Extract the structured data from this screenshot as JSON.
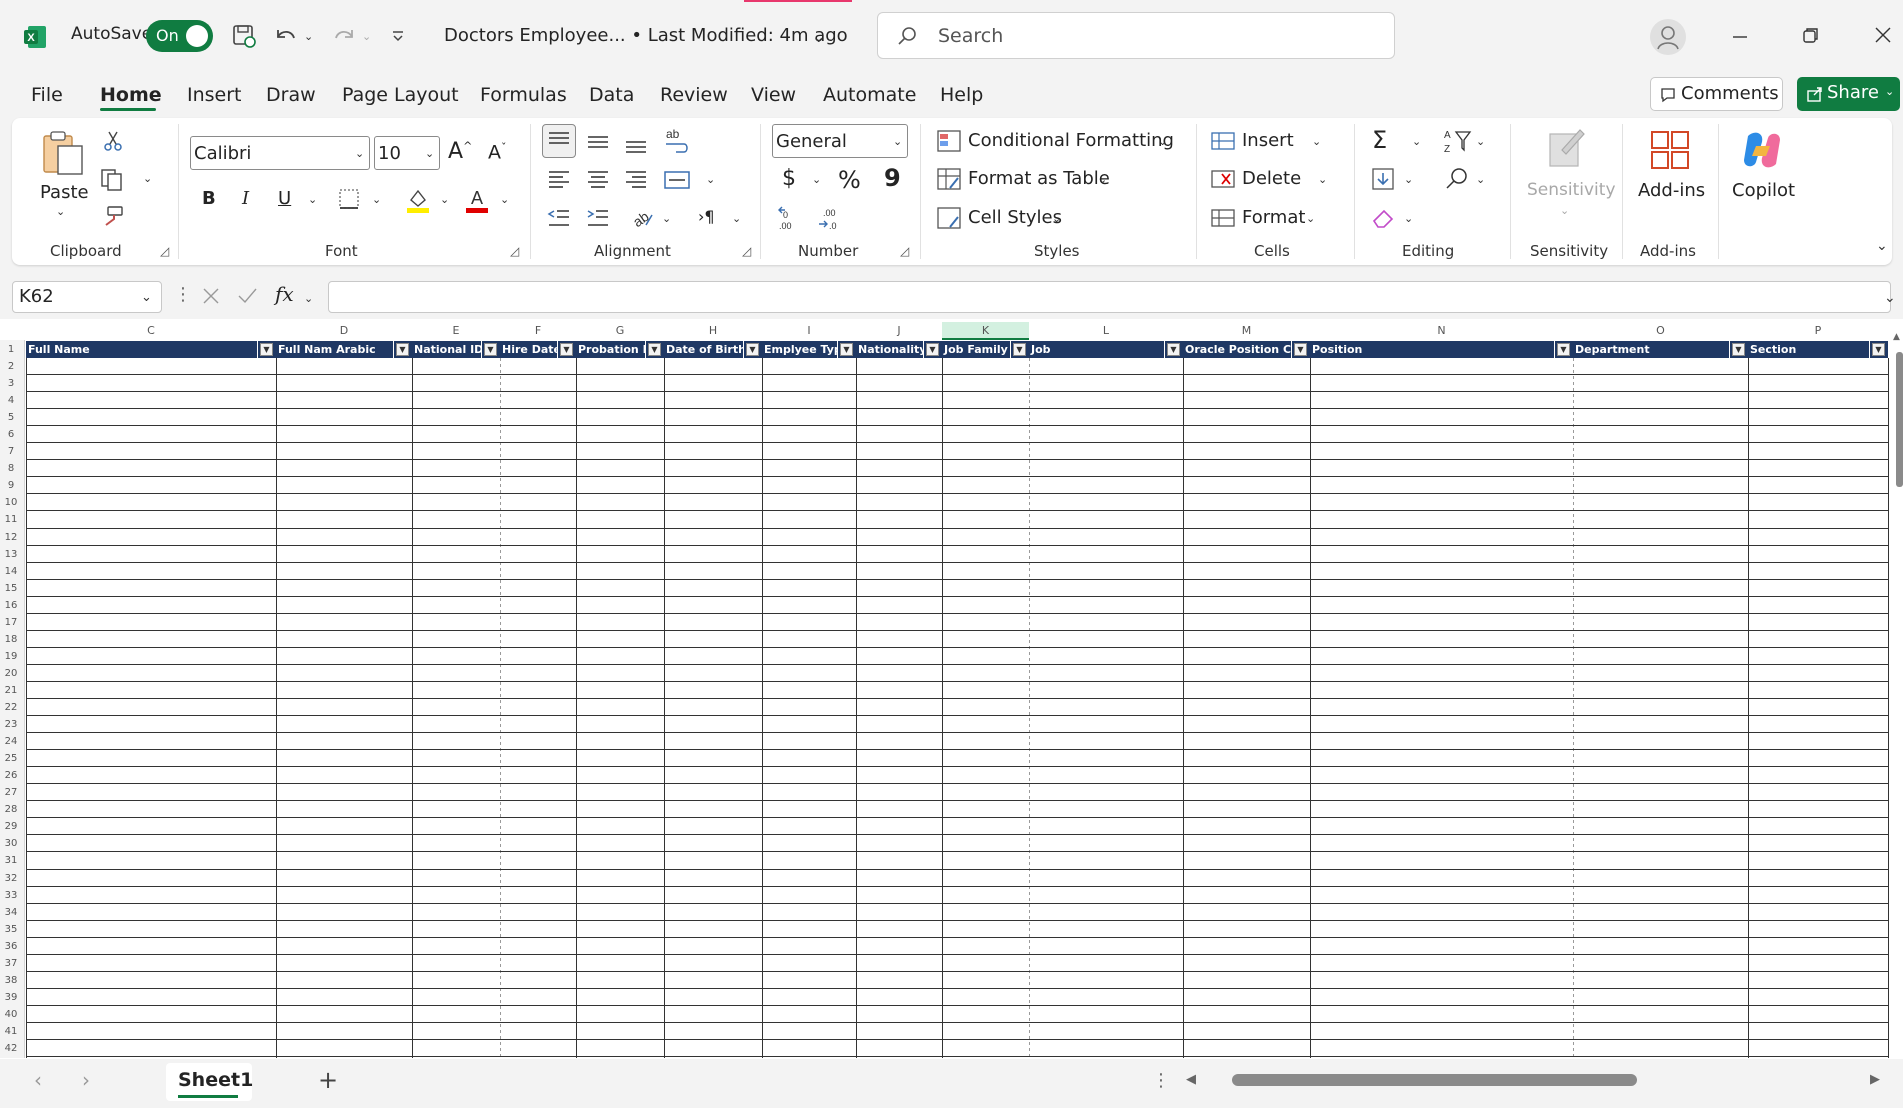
{
  "window": {
    "autosave_label": "AutoSave",
    "autosave_state": "On",
    "doc_title": "Doctors Employee...  •  Last Modified: 4m ago",
    "search_placeholder": "Search"
  },
  "tabs": [
    "File",
    "Home",
    "Insert",
    "Draw",
    "Page Layout",
    "Formulas",
    "Data",
    "Review",
    "View",
    "Automate",
    "Help"
  ],
  "active_tab": "Home",
  "actions": {
    "comments": "Comments",
    "share": "Share"
  },
  "ribbon": {
    "clipboard": {
      "paste": "Paste",
      "label": "Clipboard"
    },
    "font": {
      "name": "Calibri",
      "size": "10",
      "label": "Font",
      "bold": "B",
      "italic": "I",
      "underline": "U"
    },
    "alignment": {
      "label": "Alignment"
    },
    "number": {
      "format": "General",
      "label": "Number",
      "currency": "$",
      "percent": "%",
      "comma": "9"
    },
    "styles": {
      "conditional": "Conditional Formatting",
      "format_table": "Format as Table",
      "cell_styles": "Cell Styles",
      "label": "Styles"
    },
    "cells": {
      "insert": "Insert",
      "delete": "Delete",
      "format": "Format",
      "label": "Cells"
    },
    "editing": {
      "label": "Editing"
    },
    "sensitivity": {
      "button": "Sensitivity",
      "label": "Sensitivity"
    },
    "addins": {
      "button": "Add-ins",
      "label": "Add-ins"
    },
    "copilot": {
      "button": "Copilot"
    }
  },
  "formula_bar": {
    "name_box": "K62",
    "fx": "fx",
    "value": ""
  },
  "grid": {
    "columns": [
      {
        "letter": "C",
        "header": "Full Name"
      },
      {
        "letter": "D",
        "header": "Full Nam Arabic"
      },
      {
        "letter": "E",
        "header": "National ID"
      },
      {
        "letter": "F",
        "header": "Hire Date"
      },
      {
        "letter": "G",
        "header": "Probation E"
      },
      {
        "letter": "H",
        "header": "Date of Birth"
      },
      {
        "letter": "I",
        "header": "Emplyee Typ"
      },
      {
        "letter": "J",
        "header": "Nationality"
      },
      {
        "letter": "K",
        "header": "Job Family"
      },
      {
        "letter": "L",
        "header": "Job"
      },
      {
        "letter": "M",
        "header": "Oracle Position C"
      },
      {
        "letter": "N",
        "header": "Position"
      },
      {
        "letter": "O",
        "header": "Department"
      },
      {
        "letter": "P",
        "header": "Section"
      }
    ],
    "rows": [
      "1",
      "2",
      "3",
      "4",
      "5",
      "6",
      "7",
      "8",
      "9",
      "10",
      "11",
      "12",
      "13",
      "14",
      "15",
      "16",
      "17",
      "18",
      "19",
      "20",
      "21",
      "22",
      "23",
      "24",
      "25",
      "26",
      "27",
      "28",
      "29",
      "30",
      "31",
      "32",
      "33",
      "34",
      "35",
      "36",
      "37",
      "38",
      "39",
      "40",
      "41",
      "42"
    ],
    "selected_column": "K"
  },
  "sheet": {
    "name": "Sheet1"
  },
  "colors": {
    "accent": "#107c41",
    "table_header": "#1f3864"
  }
}
